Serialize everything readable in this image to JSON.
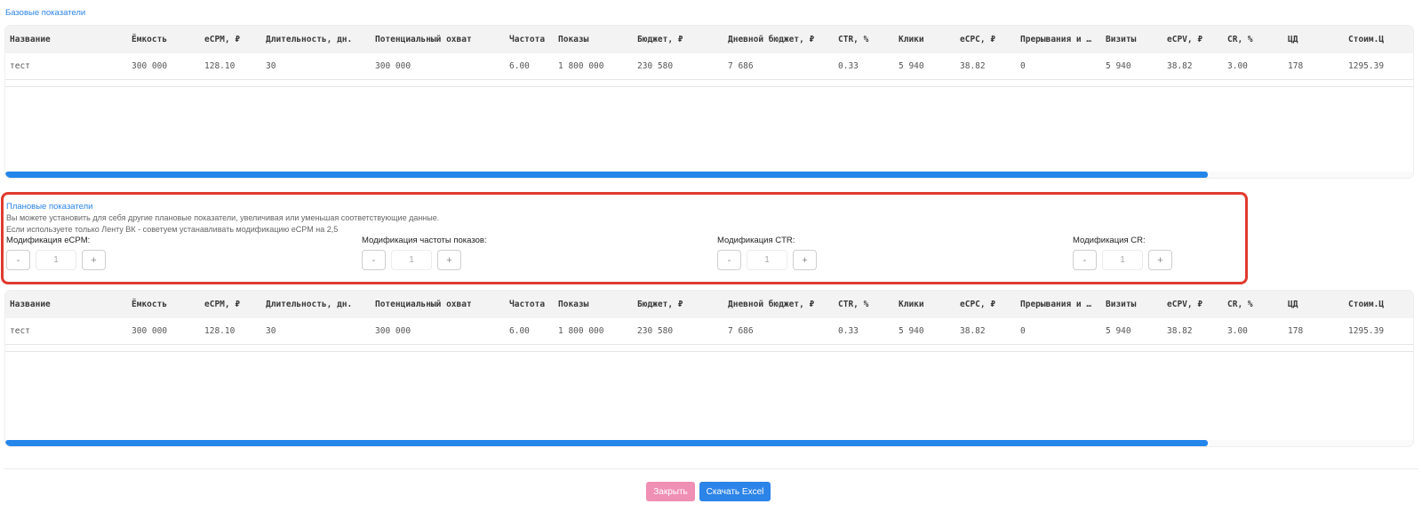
{
  "base_section": {
    "title": "Базовые показатели"
  },
  "plan_section": {
    "title": "Плановые показатели",
    "desc1": "Вы можете установить для себя другие плановые показатели, увеличивая или уменьшая соответствующие данные.",
    "desc2": "Если используете только Ленту ВК - советуем устанавливать модификацию eCPM на 2,5",
    "modifiers": [
      {
        "label": "Модификация eCPM:",
        "value": "1",
        "minus": "-",
        "plus": "+"
      },
      {
        "label": "Модификация частоты показов:",
        "value": "1",
        "minus": "-",
        "plus": "+"
      },
      {
        "label": "Модификация CTR:",
        "value": "1",
        "minus": "-",
        "plus": "+"
      },
      {
        "label": "Модификация CR:",
        "value": "1",
        "minus": "-",
        "plus": "+"
      }
    ]
  },
  "table": {
    "headers": [
      "Название",
      "Ёмкость",
      "eCPM, ₽",
      "Длительность, дн.",
      "Потенциальный охват",
      "Частота",
      "Показы",
      "Бюджет, ₽",
      "Дневной бюджет, ₽",
      "CTR, %",
      "Клики",
      "eCPC, ₽",
      "Прерывания и …",
      "Визиты",
      "eCPV, ₽",
      "CR, %",
      "ЦД",
      "Стоим.Ц"
    ],
    "row": [
      "тест",
      "300 000",
      "128.10",
      "30",
      "300 000",
      "6.00",
      "1 800 000",
      "230 580",
      "7 686",
      "0.33",
      "5 940",
      "38.82",
      "0",
      "5 940",
      "38.82",
      "3.00",
      "178",
      "1295.39"
    ]
  },
  "table2": {
    "headers": [
      "Название",
      "Ёмкость",
      "eCPM, ₽",
      "Длительность, дн.",
      "Потенциальный охват",
      "Частота",
      "Показы",
      "Бюджет, ₽",
      "Дневной бюджет, ₽",
      "CTR, %",
      "Клики",
      "eCPC, ₽",
      "Прерывания и …",
      "Визиты",
      "eCPV, ₽",
      "CR, %",
      "ЦД",
      "Стоим.Ц"
    ],
    "row": [
      "тест",
      "300 000",
      "128.10",
      "30",
      "300 000",
      "6.00",
      "1 800 000",
      "230 580",
      "7 686",
      "0.33",
      "5 940",
      "38.82",
      "0",
      "5 940",
      "38.82",
      "3.00",
      "178",
      "1295.39"
    ]
  },
  "footer": {
    "close_label": "Закрыть",
    "excel_label": "Скачать Excel"
  },
  "colors": {
    "accent": "#2c84e8",
    "highlight": "#e03a2f",
    "close_button": "#ef8fb3"
  }
}
